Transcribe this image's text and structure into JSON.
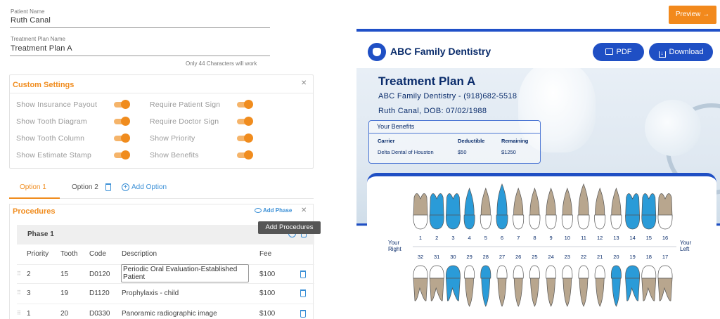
{
  "form": {
    "patient_label": "Patient Name",
    "patient_value": "Ruth Canal",
    "plan_label": "Treatment Plan Name",
    "plan_value": "Treatment Plan A",
    "char_note": "Only 44 Characters will work"
  },
  "custom_settings": {
    "title": "Custom Settings",
    "left": [
      "Show Insurance Payout",
      "Show Tooth Diagram",
      "Show Tooth Column",
      "Show Estimate Stamp"
    ],
    "right": [
      "Require Patient Sign",
      "Require Doctor Sign",
      "Show Priority",
      "Show Benefits"
    ]
  },
  "options": {
    "tab1": "Option 1",
    "tab2": "Option 2",
    "add": "Add Option"
  },
  "procedures": {
    "title": "Procedures",
    "add_phase": "Add Phase",
    "tooltip": "Add Procedures",
    "phase": "Phase 1",
    "headers": [
      "Priority",
      "Tooth",
      "Code",
      "Description",
      "Fee"
    ],
    "rows": [
      {
        "priority": "2",
        "tooth": "15",
        "code": "D0120",
        "description": "Periodic Oral Evaluation-Established Patient",
        "fee": "$100"
      },
      {
        "priority": "3",
        "tooth": "19",
        "code": "D1120",
        "description": "Prophylaxis - child",
        "fee": "$100"
      },
      {
        "priority": "1",
        "tooth": "20",
        "code": "D0330",
        "description": "Panoramic radiographic image",
        "fee": "$100"
      }
    ]
  },
  "preview": {
    "button": "Preview →",
    "brand": "ABC Family Dentistry",
    "pdf": "PDF",
    "download": "Download",
    "plan_title": "Treatment Plan A",
    "line1": "ABC Family Dentistry - (918)682-5518",
    "line2": "Ruth Canal, DOB: 07/02/1988",
    "benefits": {
      "title": "Your Benefits",
      "headers": [
        "Carrier",
        "Deductible",
        "Remaining"
      ],
      "row": [
        "Delta Dental of Houston",
        "$50",
        "$1250"
      ]
    },
    "your_right": [
      "Your",
      "Right"
    ],
    "your_left": [
      "Your",
      "Left"
    ],
    "upper_numbers": [
      "1",
      "2",
      "3",
      "4",
      "5",
      "6",
      "7",
      "8",
      "9",
      "10",
      "11",
      "12",
      "13",
      "14",
      "15",
      "16"
    ],
    "lower_numbers": [
      "32",
      "31",
      "30",
      "29",
      "28",
      "27",
      "26",
      "25",
      "24",
      "23",
      "22",
      "21",
      "20",
      "19",
      "18",
      "17"
    ],
    "upper_highlight": [
      "2",
      "3",
      "4",
      "6",
      "14",
      "15"
    ],
    "lower_highlight": [
      "30",
      "28",
      "20",
      "19"
    ],
    "colors": {
      "accent": "#f08c1e",
      "brand_blue": "#1f4fc4",
      "highlight_tooth": "#2a9bd8",
      "root": "#b8a68e"
    }
  }
}
